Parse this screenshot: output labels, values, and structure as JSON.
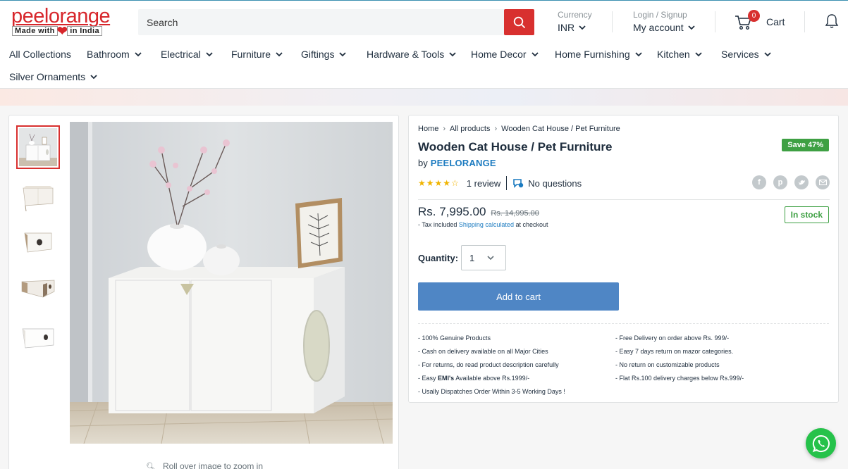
{
  "brand": {
    "logo_word": "peelorange",
    "logo_made": "Made with",
    "logo_india": "in India"
  },
  "header": {
    "search_placeholder": "Search",
    "currency_label": "Currency",
    "currency_value": "INR",
    "account_label": "Login / Signup",
    "account_value": "My account",
    "cart_count": "0",
    "cart_label": "Cart"
  },
  "nav": [
    "All Collections",
    "Bathroom",
    "Electrical",
    "Furniture",
    "Giftings",
    "Hardware & Tools",
    "Home Decor",
    "Home Furnishing",
    "Kitchen",
    "Services",
    "Silver Ornaments"
  ],
  "gallery": {
    "zoom_hint": "Roll over image to zoom in"
  },
  "product": {
    "breadcrumb": [
      "Home",
      "All products",
      "Wooden Cat House / Pet Furniture"
    ],
    "title": "Wooden Cat House / Pet Furniture",
    "by_label": "by",
    "vendor": "PEELORANGE",
    "save_badge": "Save 47%",
    "rating": {
      "stars": 4,
      "max": 5
    },
    "reviews": "1 review",
    "questions": "No questions",
    "price": "Rs. 7,995.00",
    "compare_price": "Rs. 14,995.00",
    "tax_prefix": "- Tax included",
    "tax_link": "Shipping calculated",
    "tax_suffix": "at checkout",
    "stock": "In stock",
    "quantity_label": "Quantity:",
    "quantity_value": "1",
    "add_to_cart": "Add to cart"
  },
  "features_left": [
    "- 100% Genuine Products",
    "- Cash on delivery available on all Major Cities",
    "- For returns, do read product description carefully",
    "- Easy",
    "- Usally Dispatches Order Within 3-5 Working Days !"
  ],
  "emi_bold": "EMI's",
  "emi_rest": "Available above Rs.1999/-",
  "features_right": [
    "- Free Delivery on order above Rs. 999/-",
    "- Easy 7 days return on mazor categories.",
    "- No return on customizable products",
    "- Flat Rs.100 delivery charges below Rs.999/-"
  ],
  "colors": {
    "brand_red": "#d8302f",
    "accent_blue": "#4f86c5",
    "stock_green": "#3ea043",
    "whatsapp": "#25c24a"
  }
}
